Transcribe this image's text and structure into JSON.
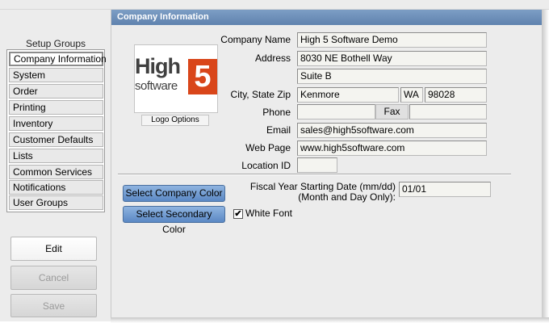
{
  "header": {
    "title": "Company Information"
  },
  "setup_groups": {
    "title": "Setup Groups",
    "items": [
      {
        "label": "Company Information",
        "active": true
      },
      {
        "label": "System"
      },
      {
        "label": "Order"
      },
      {
        "label": "Printing"
      },
      {
        "label": "Inventory"
      },
      {
        "label": "Customer Defaults"
      },
      {
        "label": "Lists"
      },
      {
        "label": "Common Services"
      },
      {
        "label": "Notifications"
      },
      {
        "label": "User Groups"
      }
    ]
  },
  "actions": {
    "edit": "Edit",
    "cancel": "Cancel",
    "save": "Save"
  },
  "logo": {
    "word1": "High",
    "word2": "software",
    "digit": "5",
    "options_label": "Logo Options",
    "accent": "#d9461a"
  },
  "form": {
    "company_name_label": "Company Name",
    "company_name": "High 5 Software Demo",
    "address_label": "Address",
    "address1": "8030 NE Bothell Way",
    "address2": "Suite B",
    "city_state_zip_label": "City, State Zip",
    "city": "Kenmore",
    "state": "WA",
    "zip": "98028",
    "phone_label": "Phone",
    "phone": "",
    "fax_label": "Fax",
    "fax": "",
    "email_label": "Email",
    "email": "sales@high5software.com",
    "web_label": "Web Page",
    "web": "www.high5software.com",
    "location_id_label": "Location ID",
    "location_id": ""
  },
  "colors": {
    "company_btn": "Select Company Color",
    "secondary_btn": "Select Secondary Color",
    "white_font_label": "White Font",
    "white_font_checked": true,
    "white_font_mark": "✔"
  },
  "fiscal": {
    "label1": "Fiscal Year Starting Date  (mm/dd)",
    "label2": "(Month and Day Only):",
    "value": "01/01"
  },
  "theme": {
    "header_bg": "#6a8cb8",
    "button_blue": "#6f9bd3",
    "panel_bg": "#ececec"
  }
}
